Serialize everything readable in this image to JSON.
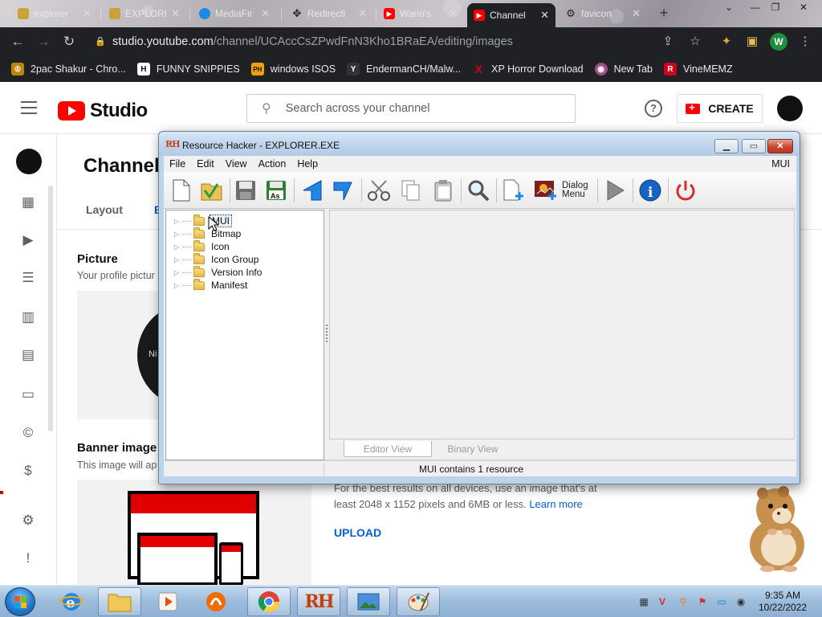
{
  "browser": {
    "tabs": [
      {
        "label": "explorer",
        "icon_color": "#c9a23a"
      },
      {
        "label": "EXPLORE",
        "icon_color": "#c9a23a"
      },
      {
        "label": "MediaFir",
        "icon_color": "#1e88e5"
      },
      {
        "label": "Redirecti",
        "icon_color": "#555555"
      },
      {
        "label": "Wario's",
        "icon_color": "#ff0000"
      },
      {
        "label": "Channel",
        "icon_color": "#ff0000",
        "active": true
      },
      {
        "label": "favicon",
        "icon_color": "#333333"
      }
    ],
    "url_host": "studio.youtube.com",
    "url_path": "/channel/UCAccCsZPwdFnN3Kho1BRaEA/editing/images",
    "profile_letter": "W",
    "bookmarks": [
      {
        "label": "2pac Shakur - Chro...",
        "icon": "crown",
        "icon_color": "#b8860b"
      },
      {
        "label": "FUNNY SNIPPIES",
        "icon_text": "H",
        "icon_color": "#222222"
      },
      {
        "label": "windows ISOS",
        "icon_text": "PH",
        "icon_color": "#f5a000"
      },
      {
        "label": "EndermanCH/Malw...",
        "icon_text": "Y",
        "icon_color": "#333333"
      },
      {
        "label": "XP Horror Download",
        "icon_text": "X",
        "icon_color": "#d0021b"
      },
      {
        "label": "New Tab",
        "icon": "globe",
        "icon_color": "#a34a8a"
      },
      {
        "label": "VineMEMZ",
        "icon_text": "R",
        "icon_color": "#d0021b"
      }
    ]
  },
  "studio": {
    "logo_text": "Studio",
    "search_placeholder": "Search across your channel",
    "create_label": "CREATE",
    "page_title": "Channel",
    "tabs": [
      "Layout",
      "B"
    ],
    "picture_title": "Picture",
    "picture_sub": "Your profile pictur",
    "picture_circle_text": "Ni",
    "banner_title": "Banner image",
    "banner_sub": "This image will ap",
    "banner_text_1": "For the best results on all devices, use an image that's at",
    "banner_text_2": "least 2048 x 1152 pixels and 6MB or less.",
    "learn_more": "Learn more",
    "upload_label": "UPLOAD",
    "sidebar_icons": [
      "dashboard-icon",
      "content-icon",
      "playlists-icon",
      "analytics-icon",
      "comments-icon",
      "subtitles-icon",
      "copyright-icon",
      "earn-icon",
      "settings-icon",
      "feedback-icon"
    ]
  },
  "resource_hacker": {
    "title": "Resource Hacker - EXPLORER.EXE",
    "icon_text": "RH",
    "menu": [
      "File",
      "Edit",
      "View",
      "Action",
      "Help"
    ],
    "menu_right": "MUI",
    "toolbar": [
      "new-file",
      "open",
      "save",
      "save-as",
      "back",
      "forward",
      "cut",
      "copy",
      "paste",
      "find",
      "add-resource",
      "add-image",
      "dialog-menu",
      "run",
      "info",
      "exit"
    ],
    "dialog_menu_label_1": "Dialog",
    "dialog_menu_label_2": "Menu",
    "tree": [
      "MUI",
      "Bitmap",
      "Icon",
      "Icon Group",
      "Version Info",
      "Manifest"
    ],
    "selected": "MUI",
    "view_tabs": [
      "Editor View",
      "Binary View"
    ],
    "status": "MUI contains 1 resource"
  },
  "taskbar": {
    "time": "9:35 AM",
    "date": "10/22/2022"
  }
}
